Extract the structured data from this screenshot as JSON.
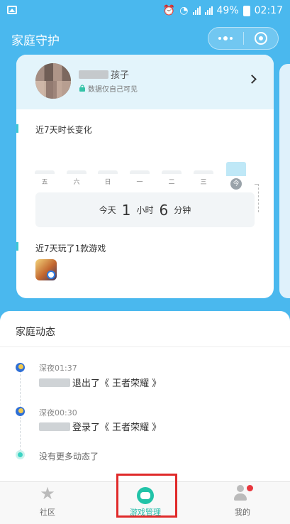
{
  "status_bar": {
    "battery": "49%",
    "time": "02:17",
    "network": "4G"
  },
  "header": {
    "title": "家庭守护"
  },
  "profile": {
    "label": "孩子",
    "privacy_note": "数据仅自己可见",
    "badge": ""
  },
  "usage": {
    "section_title": "近7天时长变化",
    "days": [
      "五",
      "六",
      "日",
      "一",
      "二",
      "三",
      "今"
    ],
    "today_label": "今天",
    "hours": "1",
    "hours_unit": "小时",
    "minutes": "6",
    "minutes_unit": "分钟"
  },
  "games": {
    "section_title": "近7天玩了1款游戏"
  },
  "family_feed": {
    "title": "家庭动态",
    "events": [
      {
        "time": "深夜01:37",
        "text": "退出了《 王者荣耀 》"
      },
      {
        "time": "深夜00:30",
        "text": "登录了《 王者荣耀 》"
      }
    ],
    "end_text": "没有更多动态了"
  },
  "tabbar": {
    "items": [
      {
        "label": "社区",
        "icon": "star-icon"
      },
      {
        "label": "游戏管理",
        "icon": "chat-bubble-icon",
        "active": true
      },
      {
        "label": "我的",
        "icon": "person-icon"
      }
    ]
  },
  "colors": {
    "primary_bg": "#4ab8ee",
    "accent": "#1fb9a6",
    "highlight": "#e02a2a"
  }
}
